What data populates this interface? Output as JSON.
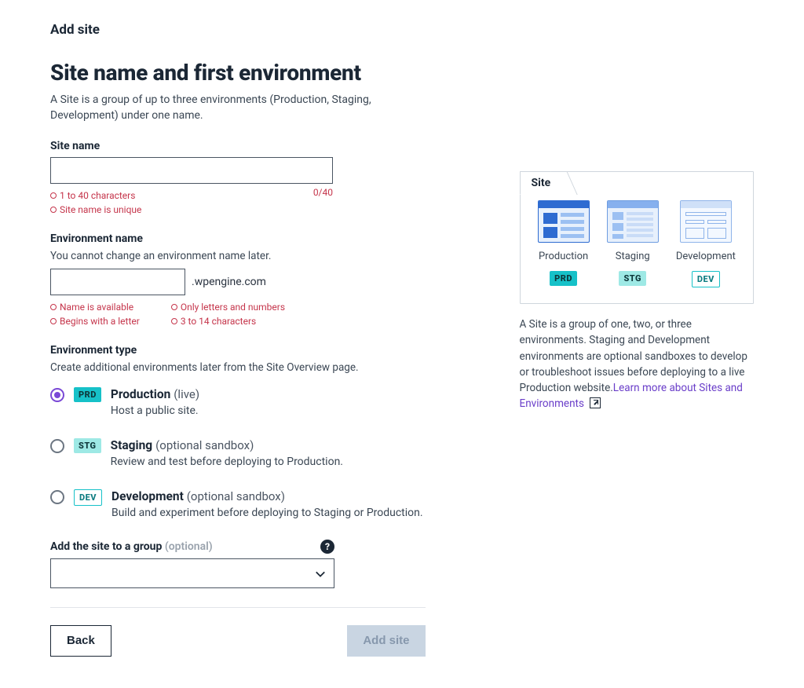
{
  "breadcrumb": "Add site",
  "title": "Site name and first environment",
  "intro": "A Site is a group of up to three environments (Production, Staging, Development) under one name.",
  "siteName": {
    "label": "Site name",
    "value": "",
    "counter": "0/40",
    "rules": [
      "1 to 40 characters",
      "Site name is unique"
    ]
  },
  "envName": {
    "label": "Environment name",
    "helper": "You cannot change an environment name later.",
    "value": "",
    "suffix": ".wpengine.com",
    "rulesLeft": [
      "Name is available",
      "Begins with a letter"
    ],
    "rulesRight": [
      "Only letters and numbers",
      "3 to 14 characters"
    ]
  },
  "envType": {
    "label": "Environment type",
    "helper": "Create additional environments later from the Site Overview page.",
    "options": [
      {
        "code": "PRD",
        "name": "Production",
        "qualifier": "(live)",
        "desc": "Host a public site.",
        "selected": true
      },
      {
        "code": "STG",
        "name": "Staging",
        "qualifier": "(optional sandbox)",
        "desc": "Review and test before deploying to Production.",
        "selected": false
      },
      {
        "code": "DEV",
        "name": "Development",
        "qualifier": "(optional sandbox)",
        "desc": "Build and experiment before deploying to Staging or Production.",
        "selected": false
      }
    ]
  },
  "group": {
    "label": "Add the site to a group",
    "optional": "(optional)",
    "value": ""
  },
  "actions": {
    "back": "Back",
    "submit": "Add site"
  },
  "illustration": {
    "tab": "Site",
    "thumbs": [
      {
        "label": "Production",
        "code": "PRD"
      },
      {
        "label": "Staging",
        "code": "STG"
      },
      {
        "label": "Development",
        "code": "DEV"
      }
    ],
    "note": "A Site is a group of one, two, or three environments. Staging and Development environments are optional sandboxes to develop or troubleshoot issues before deploying to a live Production website.",
    "link": "Learn more about Sites and Environments"
  }
}
